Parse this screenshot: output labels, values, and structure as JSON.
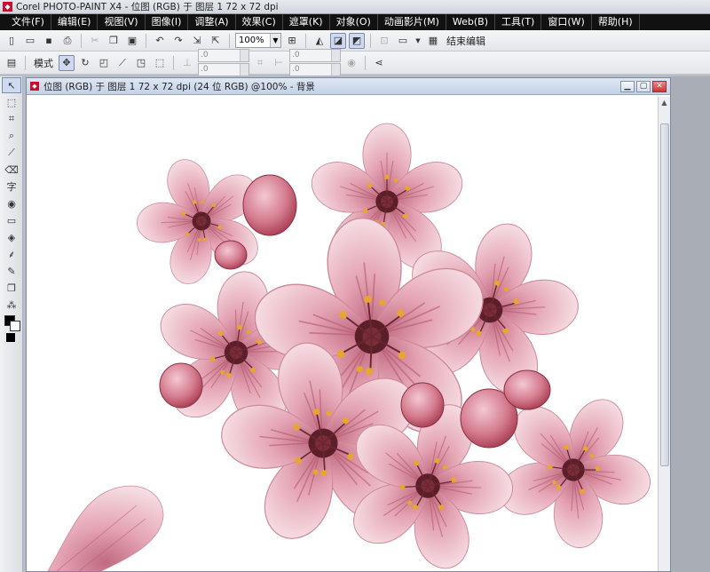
{
  "window_title": "Corel PHOTO-PAINT X4 - 位图 (RGB) 于 图层 1 72 x 72 dpi",
  "menu": [
    "文件(F)",
    "编辑(E)",
    "视图(V)",
    "图像(I)",
    "调整(A)",
    "效果(C)",
    "遮罩(K)",
    "对象(O)",
    "动画影片(M)",
    "Web(B)",
    "工具(T)",
    "窗口(W)",
    "帮助(H)"
  ],
  "toolbar": {
    "zoom_value": "100%",
    "end_edit_label": "结束编辑"
  },
  "property_bar": {
    "mode_label": "模式",
    "field_values": [
      ".0",
      ".0",
      ".0",
      ".0"
    ]
  },
  "document": {
    "title": "位图 (RGB) 于 图层 1 72 x 72 dpi (24 位 RGB) @100% - 背景"
  },
  "toolbox_text_tool": "字",
  "colors": {
    "menubar": "#111111",
    "petal_light": "#f1cdd6",
    "petal_mid": "#e4a3b3",
    "petal_dark": "#c06a80",
    "center": "#5a1f28",
    "stamen": "#e8a62a"
  }
}
